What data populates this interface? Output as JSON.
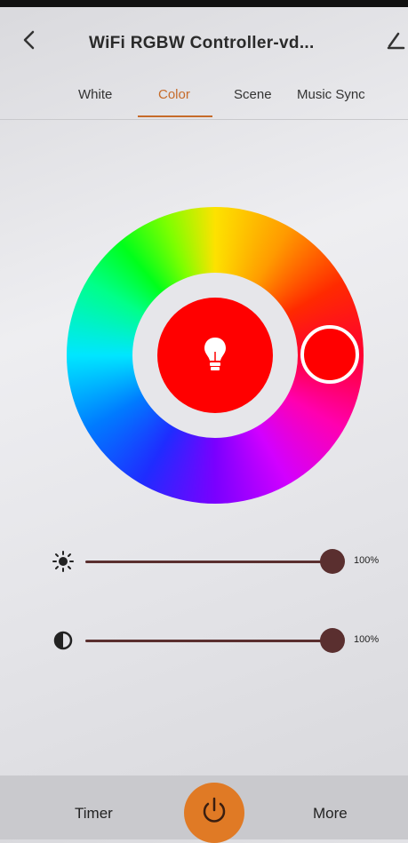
{
  "header": {
    "title": "WiFi RGBW Controller-vd...",
    "back_icon": "chevron-left-icon",
    "edit_icon": "pencil-icon"
  },
  "tabs": [
    {
      "label": "White",
      "active": false
    },
    {
      "label": "Color",
      "active": true
    },
    {
      "label": "Scene",
      "active": false
    },
    {
      "label": "Music Sync",
      "active": false
    }
  ],
  "color_wheel": {
    "selected_color": "#ff0000",
    "center_icon": "lightbulb-icon"
  },
  "sliders": {
    "brightness": {
      "icon": "sun-icon",
      "value_label": "100%",
      "value": 1.0
    },
    "saturation": {
      "icon": "contrast-icon",
      "value_label": "100%",
      "value": 1.0
    }
  },
  "bottom_bar": {
    "timer_label": "Timer",
    "more_label": "More",
    "power_icon": "power-icon"
  },
  "colors": {
    "accent": "#c66b2a",
    "power_button": "#e07a25",
    "slider": "#5a2f2f"
  }
}
